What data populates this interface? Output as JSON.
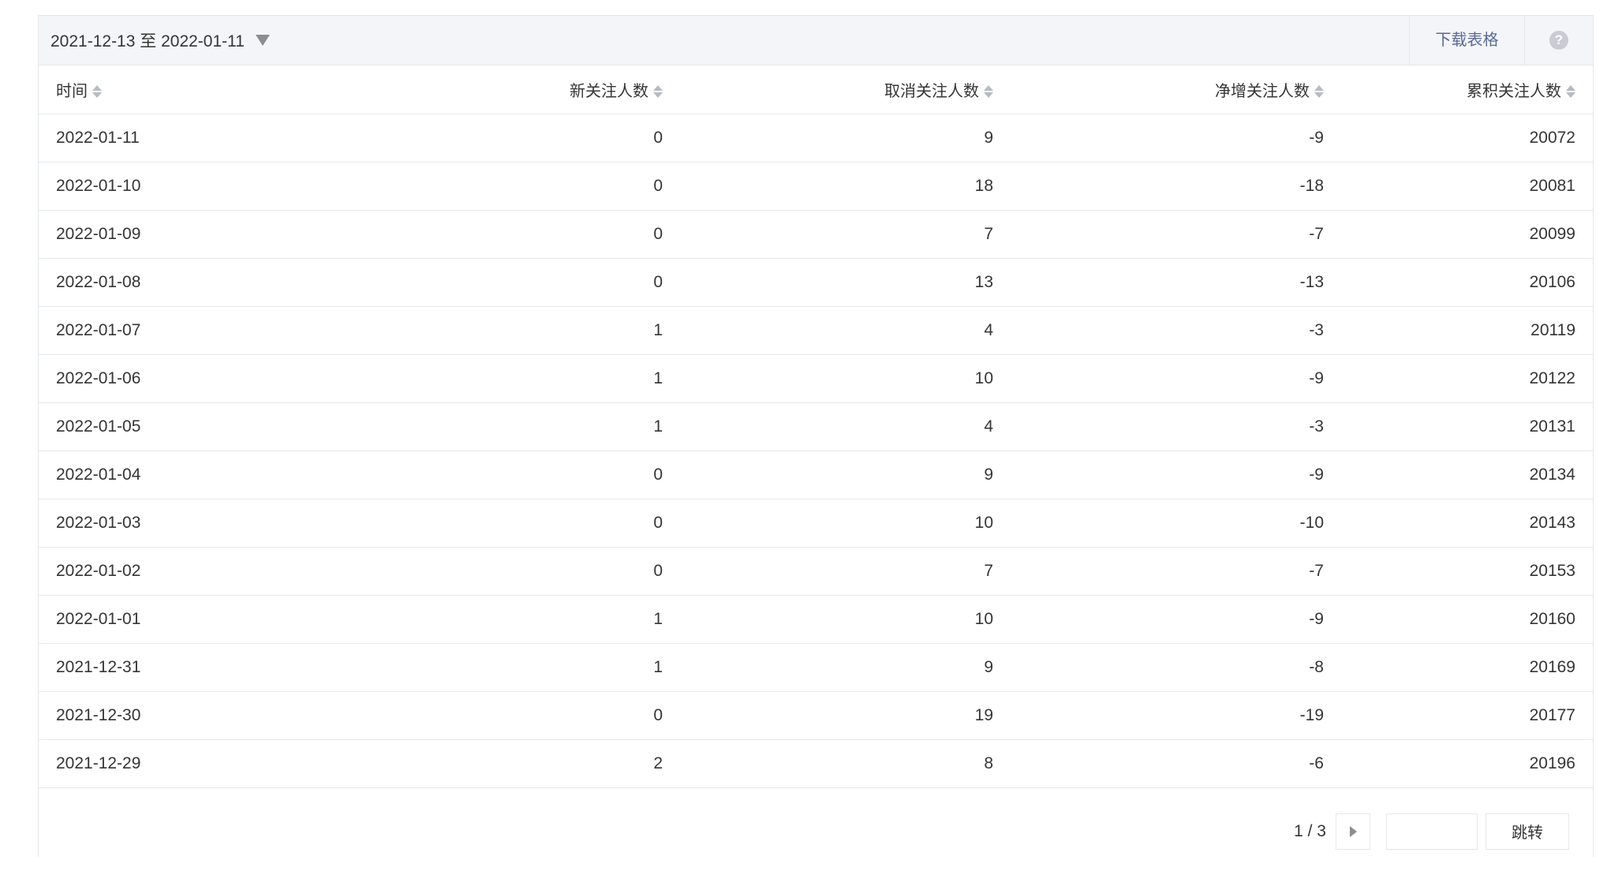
{
  "toolbar": {
    "date_range": "2021-12-13 至 2022-01-11",
    "download_label": "下载表格",
    "help_glyph": "?"
  },
  "table": {
    "headers": [
      "时间",
      "新关注人数",
      "取消关注人数",
      "净增关注人数",
      "累积关注人数"
    ],
    "rows": [
      [
        "2022-01-11",
        "0",
        "9",
        "-9",
        "20072"
      ],
      [
        "2022-01-10",
        "0",
        "18",
        "-18",
        "20081"
      ],
      [
        "2022-01-09",
        "0",
        "7",
        "-7",
        "20099"
      ],
      [
        "2022-01-08",
        "0",
        "13",
        "-13",
        "20106"
      ],
      [
        "2022-01-07",
        "1",
        "4",
        "-3",
        "20119"
      ],
      [
        "2022-01-06",
        "1",
        "10",
        "-9",
        "20122"
      ],
      [
        "2022-01-05",
        "1",
        "4",
        "-3",
        "20131"
      ],
      [
        "2022-01-04",
        "0",
        "9",
        "-9",
        "20134"
      ],
      [
        "2022-01-03",
        "0",
        "10",
        "-10",
        "20143"
      ],
      [
        "2022-01-02",
        "0",
        "7",
        "-7",
        "20153"
      ],
      [
        "2022-01-01",
        "1",
        "10",
        "-9",
        "20160"
      ],
      [
        "2021-12-31",
        "1",
        "9",
        "-8",
        "20169"
      ],
      [
        "2021-12-30",
        "0",
        "19",
        "-19",
        "20177"
      ],
      [
        "2021-12-29",
        "2",
        "8",
        "-6",
        "20196"
      ]
    ]
  },
  "pagination": {
    "page_info": "1 / 3",
    "jump_input_value": "",
    "jump_label": "跳转"
  },
  "icons": {
    "dropdown": "caret-down-icon",
    "sort": "sort-icon",
    "next": "next-page-icon",
    "help": "help-icon"
  },
  "colors": {
    "toolbar_bg": "#f4f5f9",
    "link": "#576b95",
    "border": "#e4e8eb",
    "text": "#353535"
  }
}
